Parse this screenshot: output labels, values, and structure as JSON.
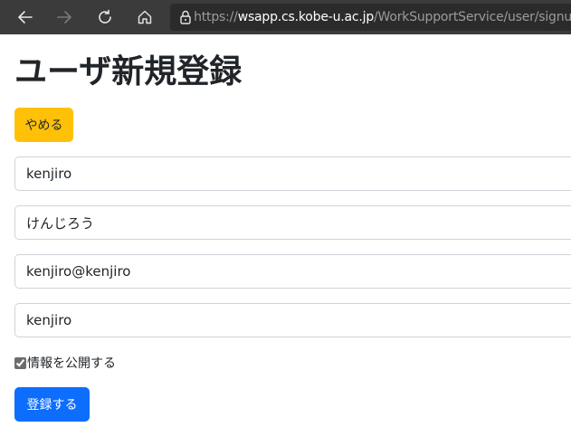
{
  "browser": {
    "url_scheme": "https://",
    "url_host": "wsapp.cs.kobe-u.ac.jp",
    "url_path": "/WorkSupportService/user/signup?",
    "icons": {
      "back": "arrow-left-icon",
      "forward": "arrow-right-icon",
      "reload": "reload-icon",
      "home": "home-icon",
      "lock": "lock-icon"
    }
  },
  "page": {
    "title": "ユーザ新規登録",
    "cancel_label": "やめる",
    "fields": [
      {
        "value": "kenjiro"
      },
      {
        "value": "けんじろう"
      },
      {
        "value": "kenjiro@kenjiro"
      },
      {
        "value": "kenjiro"
      }
    ],
    "publish_checkbox": {
      "label": "情報を公開する",
      "checked": true
    },
    "register_label": "登録する"
  },
  "colors": {
    "toolbar_bg": "#3b3b3b",
    "address_bg": "#2b2b2b",
    "cancel_button": "#ffc107",
    "register_button": "#0d6efd"
  }
}
